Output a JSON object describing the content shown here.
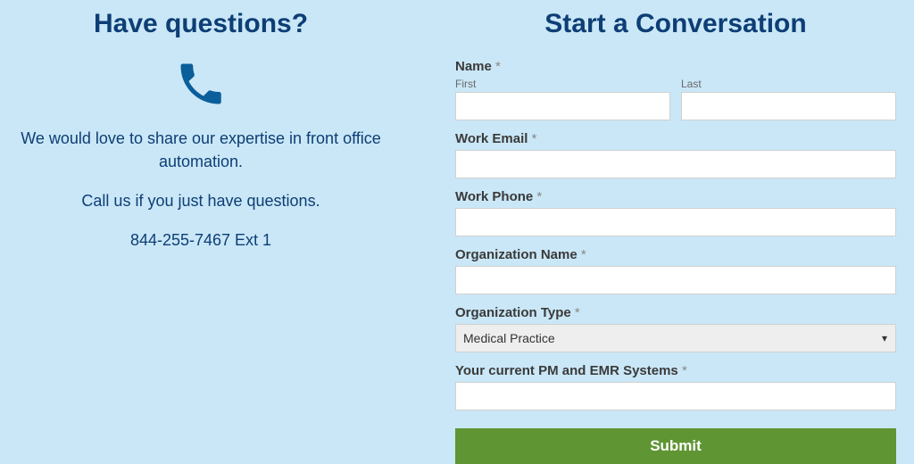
{
  "left": {
    "title": "Have questions?",
    "line1": "We would love to share our expertise in front office automation.",
    "line2": "Call us if you just have questions.",
    "phone": "844-255-7467 Ext 1"
  },
  "right": {
    "title": "Start a Conversation",
    "name_label": "Name",
    "first_sub": "First",
    "last_sub": "Last",
    "email_label": "Work Email",
    "phone_label": "Work Phone",
    "org_name_label": "Organization Name",
    "org_type_label": "Organization Type",
    "org_type_selected": "Medical Practice",
    "pm_emr_label": "Your current PM and EMR Systems",
    "submit_label": "Submit",
    "required": "*"
  }
}
